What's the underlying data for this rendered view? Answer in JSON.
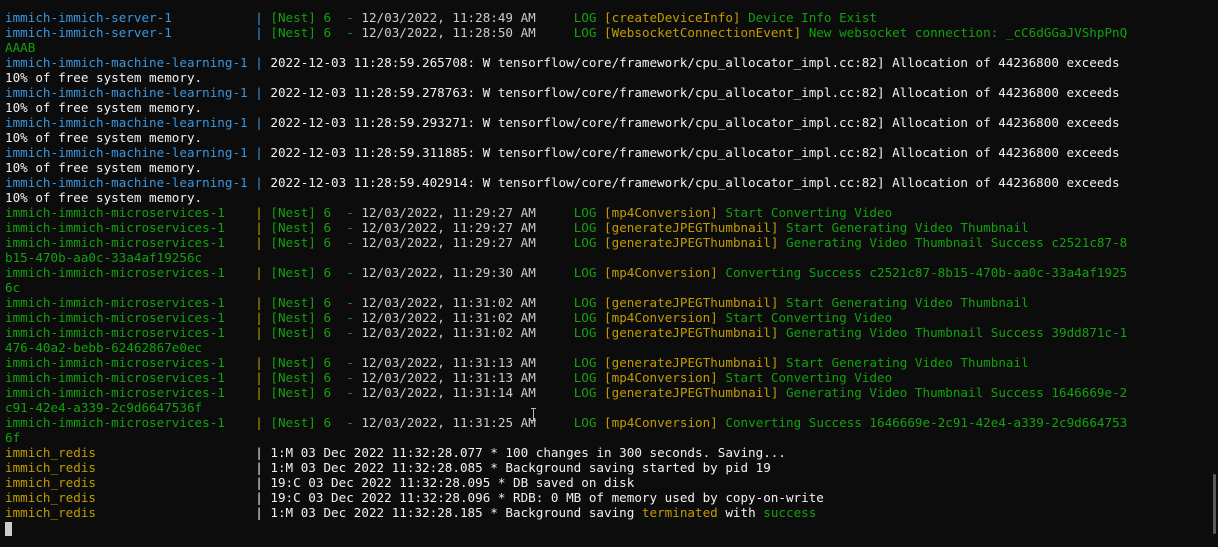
{
  "lines": [
    {
      "segs": [
        [
          "immich-immich-server-1           | ",
          "tl"
        ],
        [
          "[Nest] 6  - ",
          "gr"
        ],
        [
          "12/03/2022, 11:28:49 AM     ",
          "wt"
        ],
        [
          "LOG ",
          "gr"
        ],
        [
          "[createDeviceInfo] ",
          "yl"
        ],
        [
          "Device Info Exist",
          "gr"
        ]
      ]
    },
    {
      "segs": [
        [
          "immich-immich-server-1           | ",
          "tl"
        ],
        [
          "[Nest] 6  - ",
          "gr"
        ],
        [
          "12/03/2022, 11:28:50 AM     ",
          "wt"
        ],
        [
          "LOG ",
          "gr"
        ],
        [
          "[WebsocketConnectionEvent] ",
          "yl"
        ],
        [
          "New websocket connection: _cC6dGGaJVShpPnQ",
          "gr"
        ]
      ]
    },
    {
      "segs": [
        [
          "AAAB",
          "gr"
        ]
      ]
    },
    {
      "segs": [
        [
          "immich-immich-machine-learning-1 | ",
          "tl"
        ],
        [
          "2022-12-03 11:28:59.265708: W tensorflow/core/framework/cpu_allocator_impl.cc:82] Allocation of 44236800 exceeds",
          "bt"
        ]
      ]
    },
    {
      "segs": [
        [
          "10% of free system memory.",
          "bt"
        ]
      ]
    },
    {
      "segs": [
        [
          "immich-immich-machine-learning-1 | ",
          "tl"
        ],
        [
          "2022-12-03 11:28:59.278763: W tensorflow/core/framework/cpu_allocator_impl.cc:82] Allocation of 44236800 exceeds",
          "bt"
        ]
      ]
    },
    {
      "segs": [
        [
          "10% of free system memory.",
          "bt"
        ]
      ]
    },
    {
      "segs": [
        [
          "immich-immich-machine-learning-1 | ",
          "tl"
        ],
        [
          "2022-12-03 11:28:59.293271: W tensorflow/core/framework/cpu_allocator_impl.cc:82] Allocation of 44236800 exceeds",
          "bt"
        ]
      ]
    },
    {
      "segs": [
        [
          "10% of free system memory.",
          "bt"
        ]
      ]
    },
    {
      "segs": [
        [
          "immich-immich-machine-learning-1 | ",
          "tl"
        ],
        [
          "2022-12-03 11:28:59.311885: W tensorflow/core/framework/cpu_allocator_impl.cc:82] Allocation of 44236800 exceeds",
          "bt"
        ]
      ]
    },
    {
      "segs": [
        [
          "10% of free system memory.",
          "bt"
        ]
      ]
    },
    {
      "segs": [
        [
          "immich-immich-machine-learning-1 | ",
          "tl"
        ],
        [
          "2022-12-03 11:28:59.402914: W tensorflow/core/framework/cpu_allocator_impl.cc:82] Allocation of 44236800 exceeds",
          "bt"
        ]
      ]
    },
    {
      "segs": [
        [
          "10% of free system memory.",
          "bt"
        ]
      ]
    },
    {
      "segs": [
        [
          "immich-immich-microservices-1    ",
          "gr"
        ],
        [
          "| ",
          "yl"
        ],
        [
          "[Nest] 6  - ",
          "gr"
        ],
        [
          "12/03/2022, 11:29:27 AM     ",
          "wt"
        ],
        [
          "LOG ",
          "gr"
        ],
        [
          "[mp4Conversion] ",
          "yl"
        ],
        [
          "Start Converting Video",
          "gr"
        ]
      ]
    },
    {
      "segs": [
        [
          "immich-immich-microservices-1    ",
          "gr"
        ],
        [
          "| ",
          "yl"
        ],
        [
          "[Nest] 6  - ",
          "gr"
        ],
        [
          "12/03/2022, 11:29:27 AM     ",
          "wt"
        ],
        [
          "LOG ",
          "gr"
        ],
        [
          "[generateJPEGThumbnail] ",
          "yl"
        ],
        [
          "Start Generating Video Thumbnail",
          "gr"
        ]
      ]
    },
    {
      "segs": [
        [
          "immich-immich-microservices-1    ",
          "gr"
        ],
        [
          "| ",
          "yl"
        ],
        [
          "[Nest] 6  - ",
          "gr"
        ],
        [
          "12/03/2022, 11:29:27 AM     ",
          "wt"
        ],
        [
          "LOG ",
          "gr"
        ],
        [
          "[generateJPEGThumbnail] ",
          "yl"
        ],
        [
          "Generating Video Thumbnail Success c2521c87-8",
          "gr"
        ]
      ]
    },
    {
      "segs": [
        [
          "b15-470b-aa0c-33a4af19256c",
          "gr"
        ]
      ]
    },
    {
      "segs": [
        [
          "immich-immich-microservices-1    ",
          "gr"
        ],
        [
          "| ",
          "yl"
        ],
        [
          "[Nest] 6  - ",
          "gr"
        ],
        [
          "12/03/2022, 11:29:30 AM     ",
          "wt"
        ],
        [
          "LOG ",
          "gr"
        ],
        [
          "[mp4Conversion] ",
          "yl"
        ],
        [
          "Converting Success c2521c87-8b15-470b-aa0c-33a4af1925",
          "gr"
        ]
      ]
    },
    {
      "segs": [
        [
          "6c",
          "gr"
        ]
      ]
    },
    {
      "segs": [
        [
          "immich-immich-microservices-1    ",
          "gr"
        ],
        [
          "| ",
          "yl"
        ],
        [
          "[Nest] 6  - ",
          "gr"
        ],
        [
          "12/03/2022, 11:31:02 AM     ",
          "wt"
        ],
        [
          "LOG ",
          "gr"
        ],
        [
          "[generateJPEGThumbnail] ",
          "yl"
        ],
        [
          "Start Generating Video Thumbnail",
          "gr"
        ]
      ]
    },
    {
      "segs": [
        [
          "immich-immich-microservices-1    ",
          "gr"
        ],
        [
          "| ",
          "yl"
        ],
        [
          "[Nest] 6  - ",
          "gr"
        ],
        [
          "12/03/2022, 11:31:02 AM     ",
          "wt"
        ],
        [
          "LOG ",
          "gr"
        ],
        [
          "[mp4Conversion] ",
          "yl"
        ],
        [
          "Start Converting Video",
          "gr"
        ]
      ]
    },
    {
      "segs": [
        [
          "immich-immich-microservices-1    ",
          "gr"
        ],
        [
          "| ",
          "yl"
        ],
        [
          "[Nest] 6  - ",
          "gr"
        ],
        [
          "12/03/2022, 11:31:02 AM     ",
          "wt"
        ],
        [
          "LOG ",
          "gr"
        ],
        [
          "[generateJPEGThumbnail] ",
          "yl"
        ],
        [
          "Generating Video Thumbnail Success 39dd871c-1",
          "gr"
        ]
      ]
    },
    {
      "segs": [
        [
          "476-40a2-bebb-62462867e0ec",
          "gr"
        ]
      ]
    },
    {
      "segs": [
        [
          "immich-immich-microservices-1    ",
          "gr"
        ],
        [
          "| ",
          "yl"
        ],
        [
          "[Nest] 6  - ",
          "gr"
        ],
        [
          "12/03/2022, 11:31:13 AM     ",
          "wt"
        ],
        [
          "LOG ",
          "gr"
        ],
        [
          "[generateJPEGThumbnail] ",
          "yl"
        ],
        [
          "Start Generating Video Thumbnail",
          "gr"
        ]
      ]
    },
    {
      "segs": [
        [
          "immich-immich-microservices-1    ",
          "gr"
        ],
        [
          "| ",
          "yl"
        ],
        [
          "[Nest] 6  - ",
          "gr"
        ],
        [
          "12/03/2022, 11:31:13 AM     ",
          "wt"
        ],
        [
          "LOG ",
          "gr"
        ],
        [
          "[mp4Conversion] ",
          "yl"
        ],
        [
          "Start Converting Video",
          "gr"
        ]
      ]
    },
    {
      "segs": [
        [
          "immich-immich-microservices-1    ",
          "gr"
        ],
        [
          "| ",
          "yl"
        ],
        [
          "[Nest] 6  - ",
          "gr"
        ],
        [
          "12/03/2022, 11:31:14 AM     ",
          "wt"
        ],
        [
          "LOG ",
          "gr"
        ],
        [
          "[generateJPEGThumbnail] ",
          "yl"
        ],
        [
          "Generating Video Thumbnail Success 1646669e-2",
          "gr"
        ]
      ]
    },
    {
      "segs": [
        [
          "c91-42e4-a339-2c9d6647536f",
          "gr"
        ]
      ]
    },
    {
      "segs": [
        [
          "immich-immich-microservices-1    ",
          "gr"
        ],
        [
          "| ",
          "yl"
        ],
        [
          "[Nest] 6  - ",
          "gr"
        ],
        [
          "12/03/2022, 11:31:25 AM     ",
          "wt"
        ],
        [
          "LOG ",
          "gr"
        ],
        [
          "[mp4Conversion] ",
          "yl"
        ],
        [
          "Converting Success 1646669e-2c91-42e4-a339-2c9d664753",
          "gr"
        ]
      ]
    },
    {
      "segs": [
        [
          "6f",
          "gr"
        ]
      ]
    },
    {
      "segs": [
        [
          "immich_redis                     ",
          "yl"
        ],
        [
          "| ",
          "bt"
        ],
        [
          "1:M 03 Dec 2022 11:32:28.077 * 100 changes in 300 seconds. Saving...",
          "bt"
        ]
      ]
    },
    {
      "segs": [
        [
          "immich_redis                     ",
          "yl"
        ],
        [
          "| ",
          "bt"
        ],
        [
          "1:M 03 Dec 2022 11:32:28.085 * Background saving started by pid 19",
          "bt"
        ]
      ]
    },
    {
      "segs": [
        [
          "immich_redis                     ",
          "yl"
        ],
        [
          "| ",
          "bt"
        ],
        [
          "19:C 03 Dec 2022 11:32:28.095 * DB saved on disk",
          "bt"
        ]
      ]
    },
    {
      "segs": [
        [
          "immich_redis                     ",
          "yl"
        ],
        [
          "| ",
          "bt"
        ],
        [
          "19:C 03 Dec 2022 11:32:28.096 * RDB: 0 MB of memory used by copy-on-write",
          "bt"
        ]
      ]
    },
    {
      "segs": [
        [
          "immich_redis                     ",
          "yl"
        ],
        [
          "| ",
          "bt"
        ],
        [
          "1:M 03 Dec 2022 11:32:28.185 * Background saving ",
          "bt"
        ],
        [
          "terminated",
          "yl"
        ],
        [
          " with ",
          "bt"
        ],
        [
          "success",
          "gr"
        ]
      ]
    }
  ],
  "colors": {
    "background": "#0c0c0c",
    "green": "#13a10e",
    "teal": "#3a96dd",
    "yellow": "#c19c00",
    "white": "#cccccc",
    "bright_white": "#f2f2f2"
  },
  "icons": {
    "cursor": "block-cursor-icon",
    "mouse": "text-ibeam-icon"
  }
}
